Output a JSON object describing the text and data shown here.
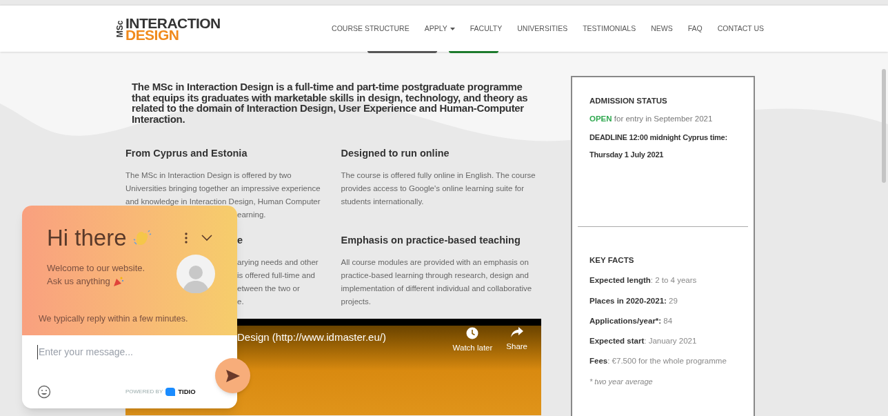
{
  "header": {
    "logo": {
      "prefix": "MSc",
      "line1": "INTERACTION",
      "line2": "DESIGN"
    },
    "nav": [
      {
        "label": "COURSE STRUCTURE",
        "dropdown": false
      },
      {
        "label": "APPLY",
        "dropdown": true
      },
      {
        "label": "FACULTY",
        "dropdown": false
      },
      {
        "label": "UNIVERSITIES",
        "dropdown": false
      },
      {
        "label": "TESTIMONIALS",
        "dropdown": false
      },
      {
        "label": "NEWS",
        "dropdown": false
      },
      {
        "label": "FAQ",
        "dropdown": false
      },
      {
        "label": "CONTACT US",
        "dropdown": false
      }
    ]
  },
  "intro": "The MSc in Interaction Design is a full-time and part-time postgraduate programme that equips its graduates with marketable skills in design, technology, and theory as related to the domain of Interaction Design, User Experience and Human-Computer Interaction.",
  "features": [
    {
      "heading": "From Cyprus and Estonia",
      "lines": [
        "The MSc in Interaction Design is offered by two",
        "Universities bringing together an impressive experience",
        "and knowledge in Interaction Design, Human Computer"
      ],
      "partly_covered_lines": [
        "earning."
      ]
    },
    {
      "heading": "Designed to run online",
      "lines": [
        "The course is offered fully online in English. The course",
        "provides access to Google's online learning suite for",
        "students internationally."
      ]
    },
    {
      "partly_covered_heading": "e",
      "partly_covered_lines": [
        "arying needs and other",
        "is offered full-time and",
        "etween the two or",
        "e."
      ]
    },
    {
      "heading": "Emphasis on practice-based teaching",
      "lines": [
        "All course modules are provided with an emphasis on",
        "practice-based learning through research, design and",
        "implementation of different individual and collaborative",
        "projects."
      ]
    }
  ],
  "video": {
    "title": "Design (http://www.idmaster.eu/)",
    "actions": [
      {
        "kind": "clock",
        "label": "Watch later"
      },
      {
        "kind": "share",
        "label": "Share"
      }
    ]
  },
  "admission": {
    "title": "ADMISSION STATUS",
    "status": "OPEN",
    "status_text": "for entry in September 2021",
    "deadline": [
      "DEADLINE 12:00 midnight Cyprus time:",
      "Thursday 1 July 2021"
    ]
  },
  "key_facts": {
    "title": "KEY FACTS",
    "items": [
      {
        "label": "Expected length",
        "value": ": 2 to 4 years"
      },
      {
        "label": "Places in 2020-2021:",
        "value": " 29"
      },
      {
        "label": "Applications/year*:",
        "value": " 84"
      },
      {
        "label": "Expected start",
        "value": ": January 2021"
      },
      {
        "label": "Fees",
        "value": ": €7.500 for the whole programme"
      }
    ],
    "note": "* two year average"
  },
  "chat": {
    "title": "Hi there",
    "welcome": [
      "Welcome to our website.",
      "Ask us anything"
    ],
    "reply_time": "We typically reply within a few minutes.",
    "placeholder": "Enter your message...",
    "powered_by": "POWERED BY",
    "brand": "TIDIO"
  }
}
